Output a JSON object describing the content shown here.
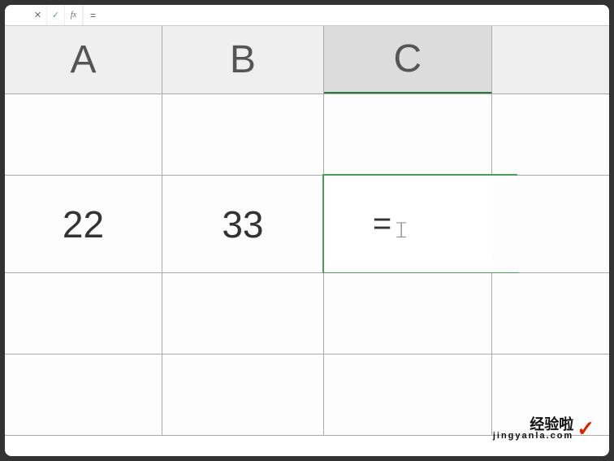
{
  "formula_bar": {
    "cancel": "✕",
    "enter": "✓",
    "fx": "fx",
    "input": "="
  },
  "columns": {
    "a": "A",
    "b": "B",
    "c": "C"
  },
  "cells": {
    "a2": "22",
    "b2": "33",
    "c2_editing": "="
  },
  "watermark": {
    "title": "经验啦",
    "url": "jingyanla.com",
    "check": "✓"
  }
}
